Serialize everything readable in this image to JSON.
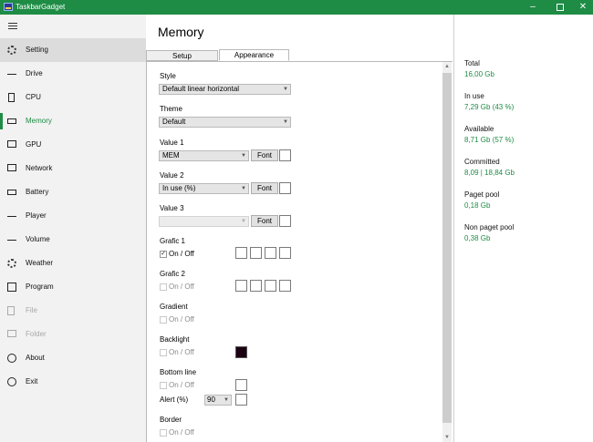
{
  "app": {
    "title": "TaskbarGadget",
    "accent": "#1e8c45"
  },
  "window_controls": {
    "minimize": "–",
    "close": "✕"
  },
  "sidebar": {
    "items": [
      {
        "label": "Setting",
        "icon": "gear-icon"
      },
      {
        "label": "Drive",
        "icon": "drive-icon"
      },
      {
        "label": "CPU",
        "icon": "cpu-icon"
      },
      {
        "label": "Memory",
        "icon": "memory-icon"
      },
      {
        "label": "GPU",
        "icon": "gpu-icon"
      },
      {
        "label": "Network",
        "icon": "network-icon"
      },
      {
        "label": "Battery",
        "icon": "battery-icon"
      },
      {
        "label": "Player",
        "icon": "player-icon"
      },
      {
        "label": "Volume",
        "icon": "volume-icon"
      },
      {
        "label": "Weather",
        "icon": "weather-icon"
      },
      {
        "label": "Program",
        "icon": "program-icon"
      },
      {
        "label": "File",
        "icon": "file-icon"
      },
      {
        "label": "Folder",
        "icon": "folder-icon"
      },
      {
        "label": "About",
        "icon": "info-icon"
      },
      {
        "label": "Exit",
        "icon": "power-icon"
      }
    ]
  },
  "main": {
    "title": "Memory",
    "tabs": [
      "Setup",
      "Appearance"
    ],
    "style": {
      "label": "Style",
      "value": "Default linear horizontal"
    },
    "theme": {
      "label": "Theme",
      "value": "Default"
    },
    "value1": {
      "label": "Value 1",
      "value": "MEM",
      "font_button": "Font"
    },
    "value2": {
      "label": "Value 2",
      "value": "In use (%)",
      "font_button": "Font"
    },
    "value3": {
      "label": "Value 3",
      "value": "",
      "font_button": "Font"
    },
    "grafic1": {
      "label": "Grafic 1",
      "toggle": "On / Off",
      "checked_mark": "✓"
    },
    "grafic2": {
      "label": "Grafic 2",
      "toggle": "On / Off"
    },
    "gradient": {
      "label": "Gradient",
      "toggle": "On / Off"
    },
    "backlight": {
      "label": "Backlight",
      "toggle": "On / Off",
      "color": "#1a0010"
    },
    "bottom_line": {
      "label": "Bottom line",
      "toggle": "On / Off",
      "alert_label": "Alert (%)",
      "alert_value": "90"
    },
    "border": {
      "label": "Border",
      "toggle": "On / Off"
    }
  },
  "stats": {
    "total": {
      "label": "Total",
      "value": "16,00 Gb"
    },
    "in_use": {
      "label": "In use",
      "value": "7,29 Gb   (43 %)"
    },
    "available": {
      "label": "Available",
      "value": "8,71 Gb   (57 %)"
    },
    "committed": {
      "label": "Committed",
      "value": "8,09 | 18,84 Gb"
    },
    "paget_pool": {
      "label": "Paget pool",
      "value": "0,18 Gb"
    },
    "non_paget_pool": {
      "label": "Non paget pool",
      "value": "0,38 Gb"
    }
  }
}
